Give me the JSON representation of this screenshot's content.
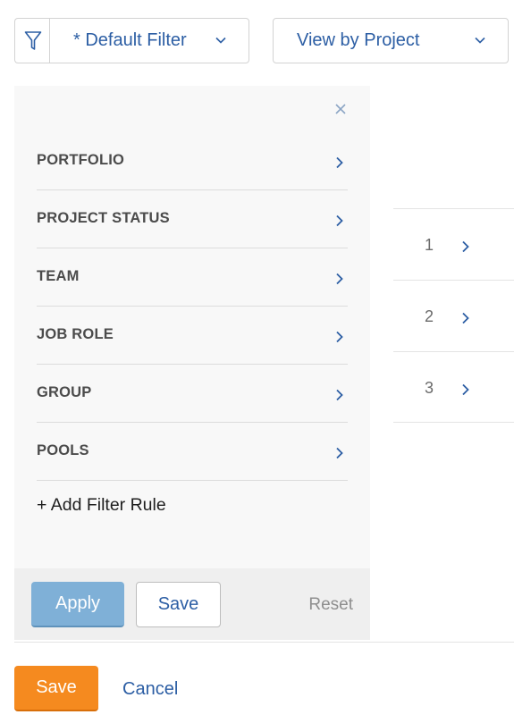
{
  "toolbar": {
    "filter_dropdown_label": "* Default Filter",
    "view_dropdown_label": "View by Project"
  },
  "filter_panel": {
    "rules": [
      {
        "label": "PORTFOLIO"
      },
      {
        "label": "PROJECT STATUS"
      },
      {
        "label": "TEAM"
      },
      {
        "label": "JOB ROLE"
      },
      {
        "label": "GROUP"
      },
      {
        "label": "POOLS"
      }
    ],
    "add_rule_label": "+ Add Filter Rule",
    "apply_label": "Apply",
    "save_label": "Save",
    "reset_label": "Reset"
  },
  "background_list": {
    "items": [
      {
        "number": "1"
      },
      {
        "number": "2"
      },
      {
        "number": "3"
      }
    ]
  },
  "footer": {
    "save_label": "Save",
    "cancel_label": "Cancel"
  },
  "colors": {
    "accent_blue": "#2c5ea4",
    "apply_blue": "#7fb0d7",
    "primary_orange": "#f58a1f",
    "panel_bg": "#f8f8f8"
  },
  "icons": {
    "filter": "funnel-icon",
    "dropdown": "chevron-down-icon",
    "row": "chevron-right-icon",
    "close": "close-icon"
  }
}
